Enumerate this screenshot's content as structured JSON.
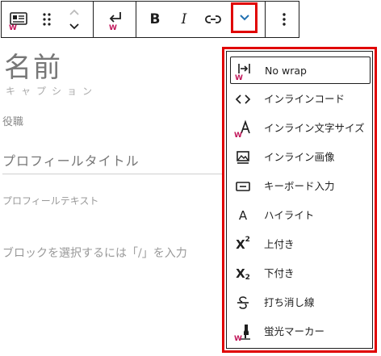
{
  "toolbar": {
    "bold_label": "B",
    "italic_label": "I",
    "highlight_color": "#e00000"
  },
  "editor": {
    "name_heading": "名前",
    "caption": "キャプション",
    "role": "役職",
    "profile_title": "プロフィールタイトル",
    "profile_text": "プロフィールテキスト",
    "block_placeholder": "ブロックを選択するには「/」を入力"
  },
  "format_menu": {
    "items": [
      {
        "label": "No wrap",
        "icon": "no-wrap-icon"
      },
      {
        "label": "インラインコード",
        "icon": "code-icon"
      },
      {
        "label": "インライン文字サイズ",
        "icon": "font-size-icon"
      },
      {
        "label": "インライン画像",
        "icon": "image-icon"
      },
      {
        "label": "キーボード入力",
        "icon": "keyboard-icon"
      },
      {
        "label": "ハイライト",
        "icon": "highlight-icon"
      },
      {
        "label": "上付き",
        "icon": "superscript-icon"
      },
      {
        "label": "下付き",
        "icon": "subscript-icon"
      },
      {
        "label": "打ち消し線",
        "icon": "strikethrough-icon"
      },
      {
        "label": "蛍光マーカー",
        "icon": "marker-icon"
      }
    ],
    "glyphs": {
      "highlight": "A",
      "superscript_base": "X",
      "superscript_exp": "2",
      "subscript_base": "X",
      "subscript_exp": "2"
    }
  }
}
